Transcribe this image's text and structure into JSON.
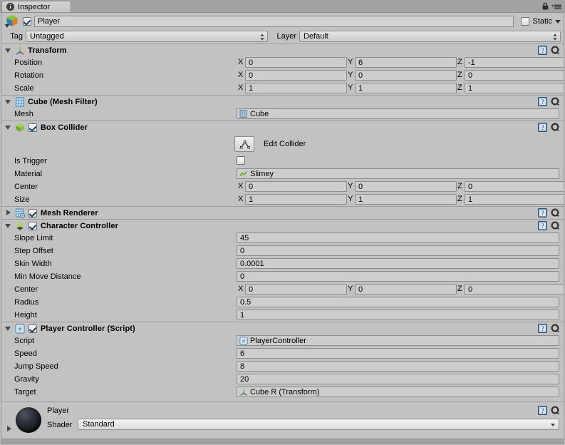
{
  "window": {
    "tab_label": "Inspector",
    "tab_icon": "info-icon",
    "lock_icon": "lock-icon",
    "menu_icon": "hamburger-menu-icon"
  },
  "object_header": {
    "gameobject_icon": "cube-gameobject-icon",
    "enabled": true,
    "name": "Player",
    "static_label": "Static",
    "static_checked": false,
    "tag_label": "Tag",
    "tag_value": "Untagged",
    "layer_label": "Layer",
    "layer_value": "Default"
  },
  "components": [
    {
      "title": "Transform",
      "icon": "transform-axis-icon",
      "expanded": true,
      "has_toggle": false,
      "rows": [
        {
          "type": "vector3",
          "label": "Position",
          "x": "0",
          "y": "6",
          "z": "-1"
        },
        {
          "type": "vector3",
          "label": "Rotation",
          "x": "0",
          "y": "0",
          "z": "0"
        },
        {
          "type": "vector3",
          "label": "Scale",
          "x": "1",
          "y": "1",
          "z": "1"
        }
      ]
    },
    {
      "title": "Cube (Mesh Filter)",
      "icon": "mesh-filter-icon",
      "expanded": true,
      "has_toggle": false,
      "rows": [
        {
          "type": "object",
          "label": "Mesh",
          "value": "Cube",
          "value_icon": "mesh-asset-icon"
        }
      ]
    },
    {
      "title": "Box Collider",
      "icon": "box-collider-icon",
      "expanded": true,
      "has_toggle": true,
      "enabled": true,
      "rows": [
        {
          "type": "button",
          "label": "",
          "button_label": "Edit Collider",
          "button_icon": "edit-collider-icon"
        },
        {
          "type": "checkbox",
          "label": "Is Trigger",
          "checked": false
        },
        {
          "type": "object",
          "label": "Material",
          "value": "Slimey",
          "value_icon": "physic-material-icon"
        },
        {
          "type": "vector3",
          "label": "Center",
          "x": "0",
          "y": "0",
          "z": "0"
        },
        {
          "type": "vector3",
          "label": "Size",
          "x": "1",
          "y": "1",
          "z": "1"
        }
      ]
    },
    {
      "title": "Mesh Renderer",
      "icon": "mesh-renderer-icon",
      "expanded": false,
      "has_toggle": true,
      "enabled": true,
      "rows": []
    },
    {
      "title": "Character Controller",
      "icon": "character-controller-icon",
      "expanded": true,
      "has_toggle": true,
      "enabled": true,
      "rows": [
        {
          "type": "text",
          "label": "Slope Limit",
          "value": "45"
        },
        {
          "type": "text",
          "label": "Step Offset",
          "value": "0"
        },
        {
          "type": "text",
          "label": "Skin Width",
          "value": "0.0001"
        },
        {
          "type": "text",
          "label": "Min Move Distance",
          "value": "0"
        },
        {
          "type": "vector3",
          "label": "Center",
          "x": "0",
          "y": "0",
          "z": "0"
        },
        {
          "type": "text",
          "label": "Radius",
          "value": "0.5"
        },
        {
          "type": "text",
          "label": "Height",
          "value": "1"
        }
      ]
    },
    {
      "title": "Player Controller (Script)",
      "icon": "csharp-script-icon",
      "expanded": true,
      "has_toggle": true,
      "enabled": true,
      "rows": [
        {
          "type": "object",
          "label": "Script",
          "value": "PlayerController",
          "value_icon": "csharp-script-icon"
        },
        {
          "type": "text",
          "label": "Speed",
          "value": "6"
        },
        {
          "type": "text",
          "label": "Jump Speed",
          "value": "8"
        },
        {
          "type": "text",
          "label": "Gravity",
          "value": "20"
        },
        {
          "type": "object",
          "label": "Target",
          "value": "Cube R (Transform)",
          "value_icon": "transform-axis-icon"
        }
      ]
    }
  ],
  "material_preview": {
    "name": "Player",
    "shader_label": "Shader",
    "shader_value": "Standard",
    "expanded": false,
    "preview_icon": "material-sphere-preview"
  },
  "colors": {
    "panel_bg": "#c2c2c2",
    "field_bg": "#cdcdcd",
    "chrome_bg": "#a2a2a2",
    "border": "#8d8d8d",
    "text": "#000000"
  }
}
